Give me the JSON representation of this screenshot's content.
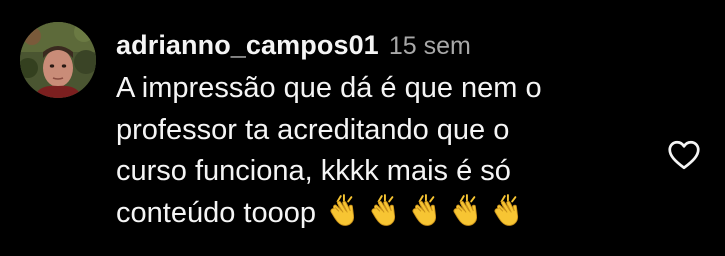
{
  "comment": {
    "username": "adrianno_campos01",
    "time": "15 sem",
    "text_lines": [
      "A impressão que dá é que nem o",
      "professor ta acreditando que o",
      "curso funciona, kkkk mais é só",
      "conteúdo tooop"
    ],
    "emoji": "clapping-hands",
    "emoji_count": 5
  },
  "icons": {
    "like": "heart-outline-icon"
  },
  "colors": {
    "background": "#000000",
    "text": "#f5f5f5",
    "secondary_text": "#a8a8a8",
    "clap": "#f7c533"
  }
}
